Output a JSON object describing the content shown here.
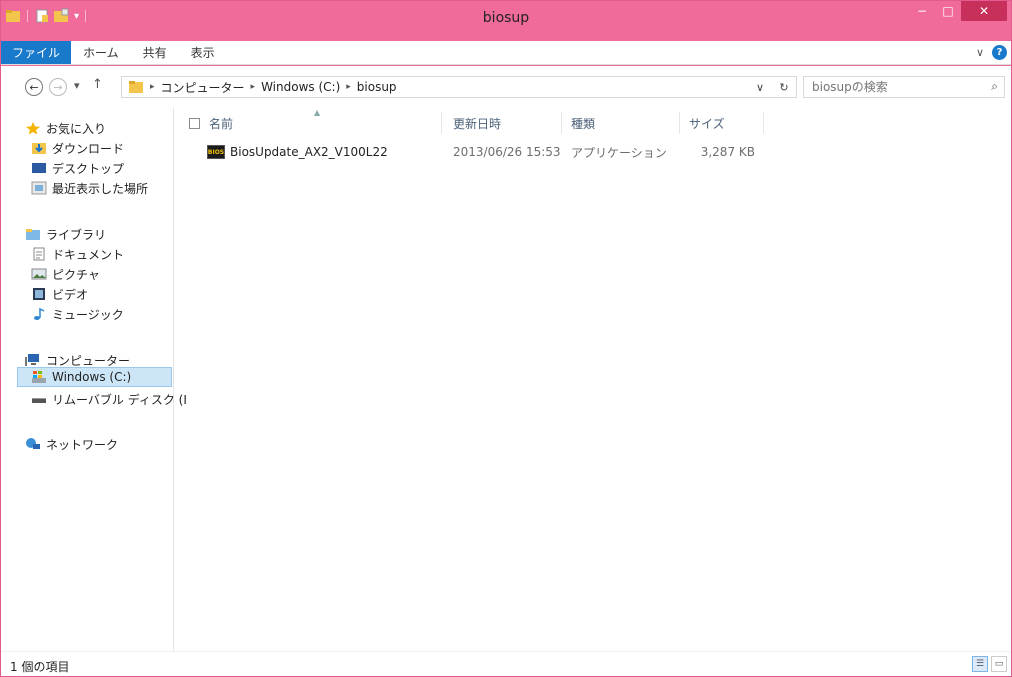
{
  "window": {
    "title": "biosup",
    "minimize": "−",
    "maximize": "□",
    "close": "✕"
  },
  "ribbon": {
    "tabs": [
      "ファイル",
      "ホーム",
      "共有",
      "表示"
    ],
    "expand": "∨",
    "help": "?"
  },
  "nav": {
    "back": "←",
    "forward": "→",
    "recent": "▾",
    "up": "↑",
    "dropdown": "∨",
    "refresh": "↻"
  },
  "address": {
    "crumbs": [
      "コンピューター",
      "Windows (C:)",
      "biosup"
    ]
  },
  "search": {
    "placeholder": "biosupの検索",
    "icon": "⌕"
  },
  "sidebar": {
    "items": [
      {
        "label": "お気に入り",
        "icon": "star-icon"
      },
      {
        "label": "ダウンロード",
        "icon": "downloads-icon"
      },
      {
        "label": "デスクトップ",
        "icon": "desktop-icon"
      },
      {
        "label": "最近表示した場所",
        "icon": "recent-places-icon"
      },
      {
        "label": "ライブラリ",
        "icon": "libraries-icon"
      },
      {
        "label": "ドキュメント",
        "icon": "documents-icon"
      },
      {
        "label": "ピクチャ",
        "icon": "pictures-icon"
      },
      {
        "label": "ビデオ",
        "icon": "videos-icon"
      },
      {
        "label": "ミュージック",
        "icon": "music-icon"
      },
      {
        "label": "コンピューター",
        "icon": "computer-icon"
      },
      {
        "label": "Windows (C:)",
        "icon": "drive-icon",
        "selected": true
      },
      {
        "label": "リムーバブル ディスク (I",
        "icon": "removable-disk-icon"
      },
      {
        "label": "ネットワーク",
        "icon": "network-icon"
      }
    ]
  },
  "filelist": {
    "columns": [
      "名前",
      "更新日時",
      "種類",
      "サイズ"
    ],
    "rows": [
      {
        "name": "BiosUpdate_AX2_V100L22",
        "modified": "2013/06/26 15:53",
        "type": "アプリケーション",
        "size": "3,287 KB",
        "icon": "application-icon",
        "icon_text": "BIOS"
      }
    ]
  },
  "status": {
    "count": "1 個の項目"
  },
  "colors": {
    "titlebar": "#f06b9a",
    "file_tab": "#1979ca",
    "selection": "#cde6f7"
  }
}
